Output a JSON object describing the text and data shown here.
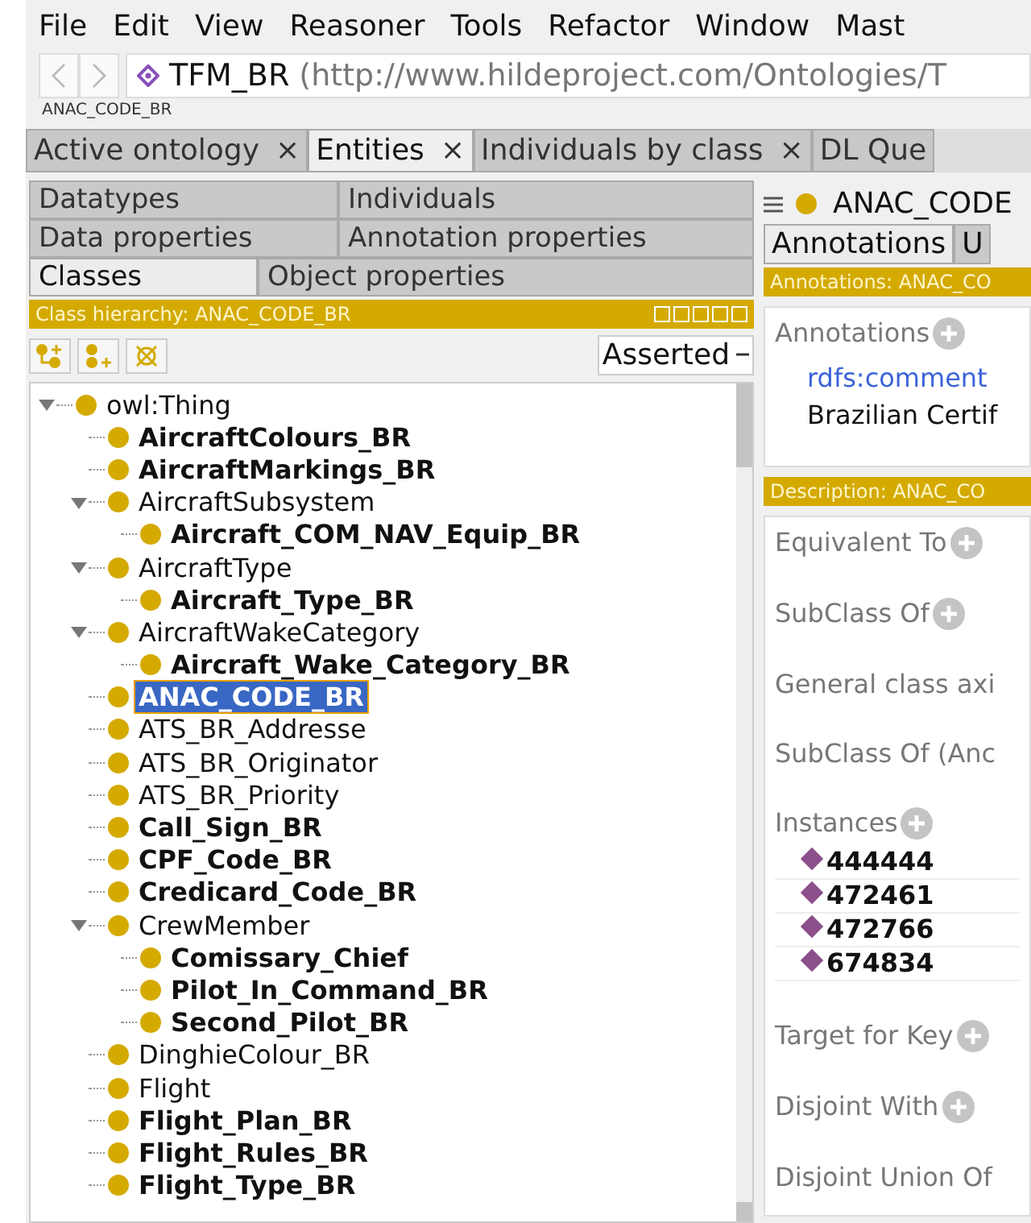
{
  "menu": [
    "File",
    "Edit",
    "View",
    "Reasoner",
    "Tools",
    "Refactor",
    "Window",
    "Mast"
  ],
  "nav": {
    "ontology": "TFM_BR",
    "iri": "(http://www.hildeproject.com/Ontologies/T",
    "breadcrumb": "ANAC_CODE_BR"
  },
  "tabs": [
    {
      "label": "Active ontology",
      "close": "×",
      "selected": false
    },
    {
      "label": "Entities",
      "close": "×",
      "selected": true
    },
    {
      "label": "Individuals by class",
      "close": "×",
      "selected": false
    },
    {
      "label": "DL Que",
      "selected": false
    }
  ],
  "entity_tabs": [
    [
      {
        "label": "Datatypes",
        "selected": false
      },
      {
        "label": "Individuals",
        "selected": false
      }
    ],
    [
      {
        "label": "Data properties",
        "selected": false
      },
      {
        "label": "Annotation properties",
        "selected": false
      }
    ],
    [
      {
        "label": "Classes",
        "selected": true
      },
      {
        "label": "Object properties",
        "selected": false
      }
    ]
  ],
  "hierarchy": {
    "title": "Class hierarchy: ANAC_CODE_BR",
    "mode": "Asserted",
    "tree": [
      {
        "label": "owl:Thing",
        "bold": false,
        "selected": false,
        "expanded": true,
        "children": [
          {
            "label": "AircraftColours_BR",
            "bold": true,
            "selected": false
          },
          {
            "label": "AircraftMarkings_BR",
            "bold": true,
            "selected": false
          },
          {
            "label": "AircraftSubsystem",
            "bold": false,
            "selected": false,
            "expanded": true,
            "children": [
              {
                "label": "Aircraft_COM_NAV_Equip_BR",
                "bold": true,
                "selected": false
              }
            ]
          },
          {
            "label": "AircraftType",
            "bold": false,
            "selected": false,
            "expanded": true,
            "children": [
              {
                "label": "Aircraft_Type_BR",
                "bold": true,
                "selected": false
              }
            ]
          },
          {
            "label": "AircraftWakeCategory",
            "bold": false,
            "selected": false,
            "expanded": true,
            "children": [
              {
                "label": "Aircraft_Wake_Category_BR",
                "bold": true,
                "selected": false
              }
            ]
          },
          {
            "label": "ANAC_CODE_BR",
            "bold": true,
            "selected": true
          },
          {
            "label": "ATS_BR_Addresse",
            "bold": false,
            "selected": false
          },
          {
            "label": "ATS_BR_Originator",
            "bold": false,
            "selected": false
          },
          {
            "label": "ATS_BR_Priority",
            "bold": false,
            "selected": false
          },
          {
            "label": "Call_Sign_BR",
            "bold": true,
            "selected": false
          },
          {
            "label": "CPF_Code_BR",
            "bold": true,
            "selected": false
          },
          {
            "label": "Credicard_Code_BR",
            "bold": true,
            "selected": false
          },
          {
            "label": "CrewMember",
            "bold": false,
            "selected": false,
            "expanded": true,
            "children": [
              {
                "label": "Comissary_Chief",
                "bold": true,
                "selected": false
              },
              {
                "label": "Pilot_In_Command_BR",
                "bold": true,
                "selected": false
              },
              {
                "label": "Second_Pilot_BR",
                "bold": true,
                "selected": false
              }
            ]
          },
          {
            "label": "DinghieColour_BR",
            "bold": false,
            "selected": false
          },
          {
            "label": "Flight",
            "bold": false,
            "selected": false
          },
          {
            "label": "Flight_Plan_BR",
            "bold": true,
            "selected": false
          },
          {
            "label": "Flight_Rules_BR",
            "bold": true,
            "selected": false
          },
          {
            "label": "Flight_Type_BR",
            "bold": true,
            "selected": false
          }
        ]
      }
    ]
  },
  "detail": {
    "title": "ANAC_CODE",
    "tabs": [
      {
        "label": "Annotations",
        "selected": true
      },
      {
        "label": "U",
        "selected": false
      }
    ],
    "annotations_header": "Annotations: ANAC_CO",
    "annotations": {
      "label": "Annotations",
      "property": "rdfs:comment",
      "value": "Brazilian Certif"
    },
    "description_header": "Description: ANAC_CO",
    "sections": [
      {
        "label": "Equivalent To",
        "add": true
      },
      {
        "label": "SubClass Of",
        "add": true
      },
      {
        "label": "General class axi",
        "add": false
      },
      {
        "label": "SubClass Of (Anc",
        "add": false
      },
      {
        "label": "Instances",
        "add": true,
        "items": [
          "444444",
          "472461",
          "472766",
          "674834"
        ]
      },
      {
        "label": "Target for Key",
        "add": true
      },
      {
        "label": "Disjoint With",
        "add": true
      },
      {
        "label": "Disjoint Union Of",
        "add": false
      }
    ]
  }
}
